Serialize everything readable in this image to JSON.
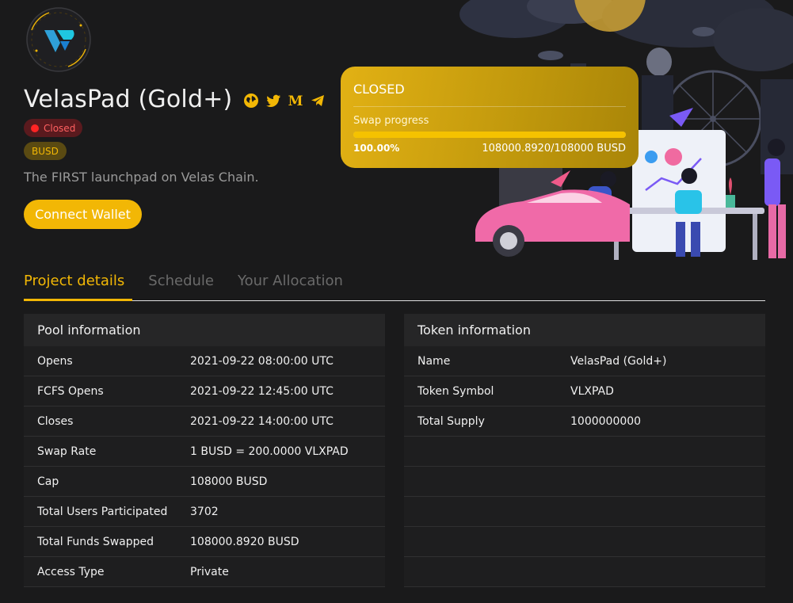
{
  "project": {
    "title": "VelasPad (Gold+)",
    "status": "Closed",
    "currency": "BUSD",
    "description": "The FIRST launchpad on Velas Chain.",
    "connect_label": "Connect Wallet",
    "social_icons": [
      "globe-icon",
      "twitter-icon",
      "medium-icon",
      "telegram-icon"
    ]
  },
  "card": {
    "status": "CLOSED",
    "progress_label": "Swap progress",
    "progress_percent": "100.00%",
    "progress_fraction": 1.0,
    "amount": "108000.8920/108000 BUSD"
  },
  "tabs": [
    {
      "label": "Project details"
    },
    {
      "label": "Schedule"
    },
    {
      "label": "Your Allocation"
    }
  ],
  "pool": {
    "title": "Pool information",
    "rows": [
      {
        "k": "Opens",
        "v": "2021-09-22 08:00:00 UTC"
      },
      {
        "k": "FCFS Opens",
        "v": "2021-09-22 12:45:00 UTC"
      },
      {
        "k": "Closes",
        "v": "2021-09-22 14:00:00 UTC"
      },
      {
        "k": "Swap Rate",
        "v": "1 BUSD = 200.0000 VLXPAD"
      },
      {
        "k": "Cap",
        "v": "108000 BUSD"
      },
      {
        "k": "Total Users Participated",
        "v": "3702"
      },
      {
        "k": "Total Funds Swapped",
        "v": "108000.8920 BUSD"
      },
      {
        "k": "Access Type",
        "v": "Private"
      }
    ]
  },
  "token": {
    "title": "Token information",
    "rows": [
      {
        "k": "Name",
        "v": "VelasPad (Gold+)"
      },
      {
        "k": "Token Symbol",
        "v": "VLXPAD"
      },
      {
        "k": "Total Supply",
        "v": "1000000000"
      },
      {
        "k": "",
        "v": ""
      },
      {
        "k": "",
        "v": ""
      },
      {
        "k": "",
        "v": ""
      },
      {
        "k": "",
        "v": ""
      },
      {
        "k": "",
        "v": ""
      }
    ]
  },
  "colors": {
    "accent": "#f2b705",
    "background": "#1a1a1b",
    "closed_red": "#ff2424"
  }
}
